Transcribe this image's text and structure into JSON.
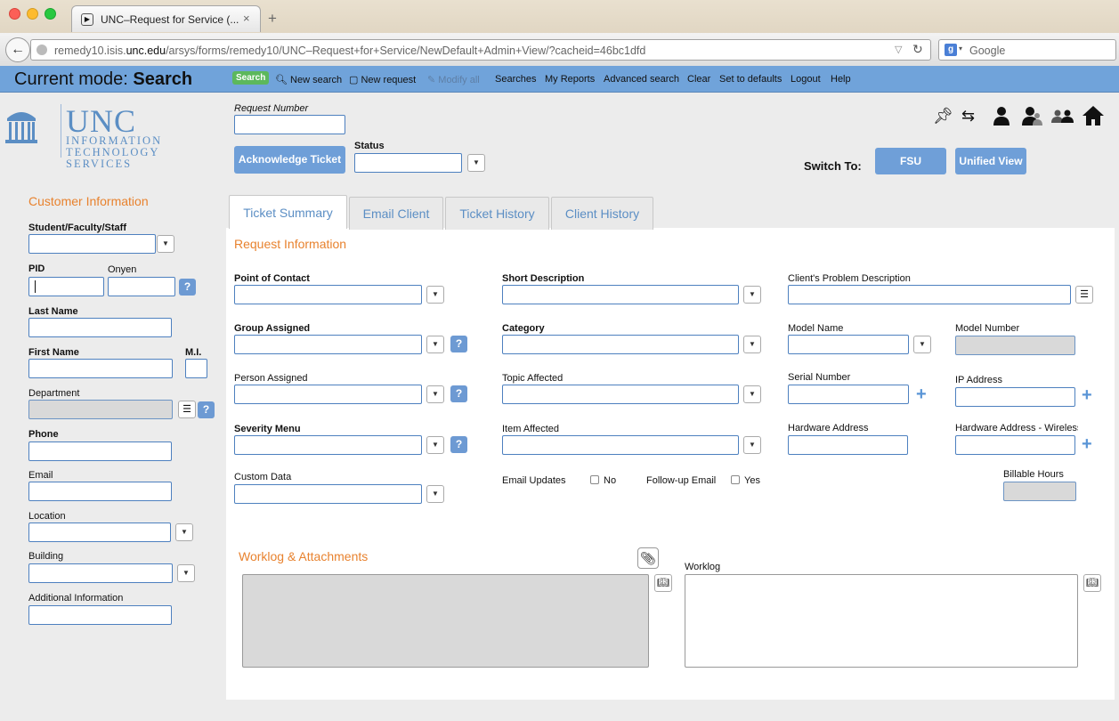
{
  "browser": {
    "tab_title": "UNC–Request for Service (...",
    "url_host_prefix": "remedy10.isis.",
    "url_host_domain": "unc.edu",
    "url_path": "/arsys/forms/remedy10/UNC–Request+for+Service/NewDefault+Admin+View/?cacheid=46bc1dfd",
    "search_engine": "Google",
    "new_tab_glyph": "+",
    "tab_close_glyph": "×"
  },
  "modebar": {
    "mode_label": "Current mode:",
    "mode_value": "Search",
    "buttons": {
      "search": "Search",
      "new_search": "New search",
      "new_request": "New request",
      "modify_all": "Modify all",
      "searches": "Searches",
      "my_reports": "My Reports",
      "advanced_search": "Advanced search",
      "clear": "Clear",
      "set_defaults": "Set to defaults",
      "logout": "Logout",
      "help": "Help"
    }
  },
  "logo": {
    "unc": "UNC",
    "line1": "INFORMATION",
    "line2": "TECHNOLOGY SERVICES"
  },
  "header": {
    "request_number_label": "Request Number",
    "acknowledge_button": "Acknowledge Ticket",
    "status_label": "Status",
    "switch_to_label": "Switch To:",
    "fsu_button": "FSU",
    "unified_view_button": "Unified View",
    "toolbar_icons": [
      "pin-icon",
      "swap-icon",
      "user-icon",
      "user-group-icon",
      "people-icon",
      "home-icon"
    ]
  },
  "customer": {
    "title": "Customer Information",
    "student_faculty_staff": "Student/Faculty/Staff",
    "pid": "PID",
    "onyen": "Onyen",
    "last_name": "Last Name",
    "first_name": "First Name",
    "mi": "M.I.",
    "department": "Department",
    "phone": "Phone",
    "email": "Email",
    "location": "Location",
    "building": "Building",
    "additional_information": "Additional Information"
  },
  "tabs": [
    "Ticket Summary",
    "Email Client",
    "Ticket History",
    "Client History"
  ],
  "request": {
    "title": "Request Information",
    "point_of_contact": "Point of Contact",
    "group_assigned": "Group Assigned",
    "person_assigned": "Person Assigned",
    "severity_menu": "Severity Menu",
    "custom_data": "Custom Data",
    "short_description": "Short Description",
    "category": "Category",
    "topic_affected": "Topic Affected",
    "item_affected": "Item Affected",
    "email_updates": "Email Updates",
    "email_updates_option": "No",
    "followup_email": "Follow-up Email",
    "followup_option": "Yes",
    "client_problem_description": "Client's Problem Description",
    "model_name": "Model Name",
    "model_number": "Model Number",
    "serial_number": "Serial Number",
    "ip_address": "IP Address",
    "hardware_address": "Hardware Address",
    "hardware_address_wireless": "Hardware Address - Wireless",
    "billable_hours": "Billable Hours"
  },
  "worklog": {
    "title": "Worklog & Attachments",
    "worklog_label": "Worklog"
  },
  "colors": {
    "modebar": "#70a3da",
    "accent_orange": "#e8822e",
    "button_blue": "#6f9fd8",
    "search_green": "#5cb85c"
  }
}
